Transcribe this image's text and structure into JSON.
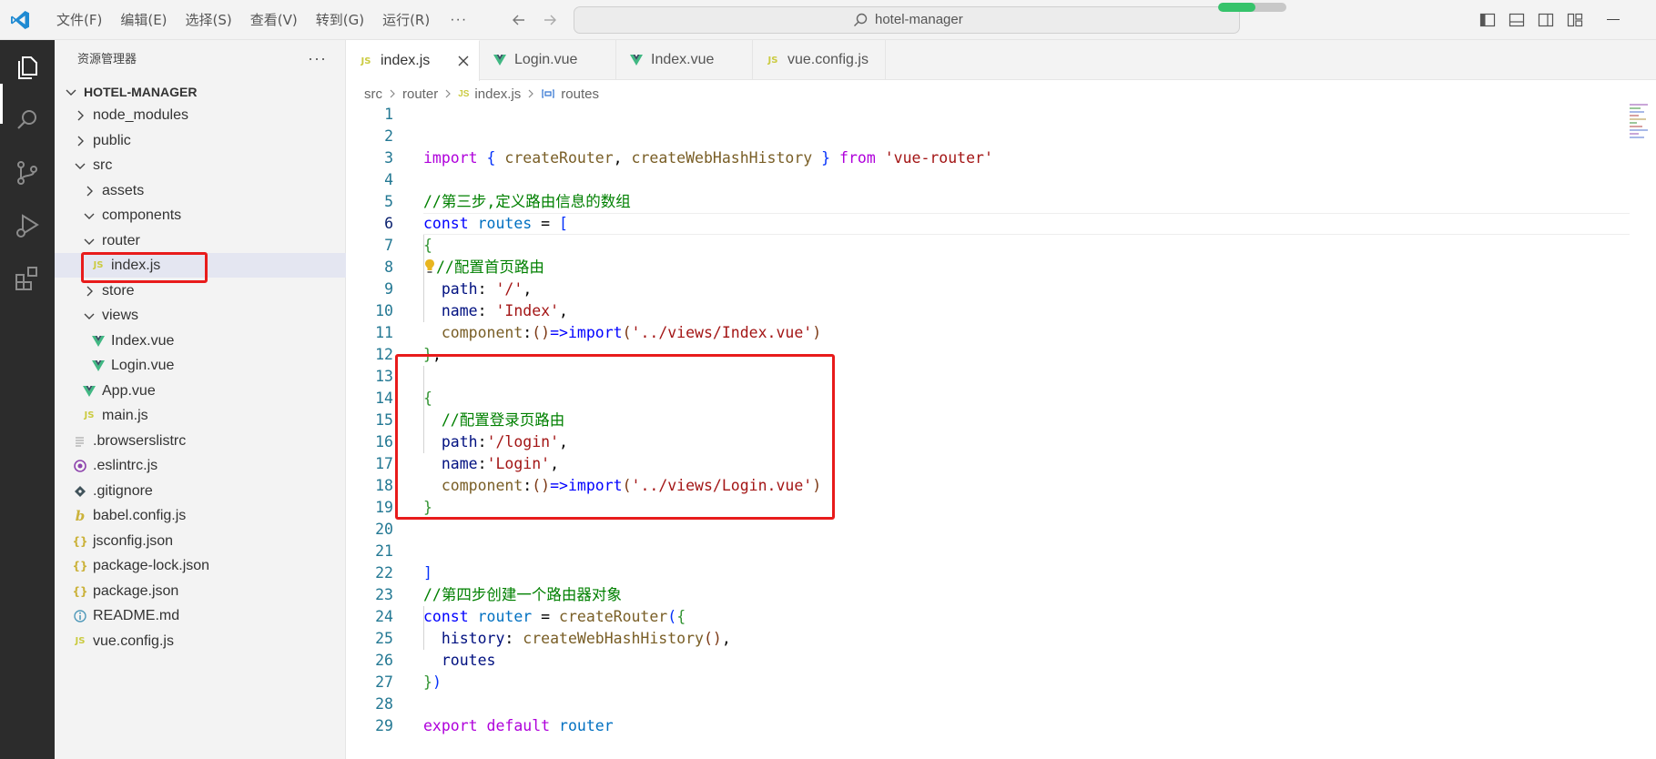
{
  "titlebar": {
    "menu": [
      "文件(F)",
      "编辑(E)",
      "选择(S)",
      "查看(V)",
      "转到(G)",
      "运行(R)"
    ],
    "more": "···",
    "command_center_title": "hotel-manager",
    "progress_fraction": 0.55
  },
  "sidebar": {
    "header": "资源管理器",
    "more": "···",
    "root": "HOTEL-MANAGER",
    "items": [
      {
        "label": "node_modules"
      },
      {
        "label": "public"
      },
      {
        "label": "src"
      },
      {
        "label": "assets"
      },
      {
        "label": "components"
      },
      {
        "label": "router"
      },
      {
        "label": "index.js"
      },
      {
        "label": "store"
      },
      {
        "label": "views"
      },
      {
        "label": "Index.vue"
      },
      {
        "label": "Login.vue"
      },
      {
        "label": "App.vue"
      },
      {
        "label": "main.js"
      },
      {
        "label": ".browserslistrc"
      },
      {
        "label": ".eslintrc.js"
      },
      {
        "label": ".gitignore"
      },
      {
        "label": "babel.config.js"
      },
      {
        "label": "jsconfig.json"
      },
      {
        "label": "package-lock.json"
      },
      {
        "label": "package.json"
      },
      {
        "label": "README.md"
      },
      {
        "label": "vue.config.js"
      }
    ]
  },
  "tabs": [
    {
      "label": "index.js",
      "icon": "JS"
    },
    {
      "label": "Login.vue",
      "icon": "V"
    },
    {
      "label": "Index.vue",
      "icon": "V"
    },
    {
      "label": "vue.config.js",
      "icon": "JS"
    }
  ],
  "breadcrumb": {
    "parts": [
      "src",
      "router",
      "index.js",
      "routes"
    ],
    "file_icon": "JS"
  },
  "editor": {
    "current_line": 6,
    "line_numbers": [
      "1",
      "2",
      "3",
      "4",
      "5",
      "6",
      "7",
      "8",
      "9",
      "10",
      "11",
      "12",
      "13",
      "14",
      "15",
      "16",
      "17",
      "18",
      "19",
      "20",
      "21",
      "22",
      "23",
      "24",
      "25",
      "26",
      "27",
      "28",
      "29"
    ],
    "t": {
      "import": "import",
      "lbrace": "{",
      "createRouter": "createRouter",
      "comma": ",",
      "createWebHashHistory": "createWebHashHistory",
      "rbrace": "}",
      "from": "from",
      "vue_router": "'vue-router'",
      "comment_step3": "//第三步,定义路由信息的数组",
      "const": "const",
      "routes": "routes",
      "eq": "=",
      "lbracket": "[",
      "comment_home": "//配置首页路由",
      "path": "path",
      "colon": ":",
      "slash_str": "'/'",
      "name": "name",
      "index_str": "'Index'",
      "component": "component",
      "arrow_lp": "(",
      "arrow_rp": ")",
      "arrow": "=>",
      "index_vue": "'../views/Index.vue'",
      "rbrace_comma": "},",
      "comment_login": "//配置登录页路由",
      "login_path": "'/login'",
      "login_name": "'Login'",
      "login_vue": "'../views/Login.vue'",
      "rbracket": "]",
      "comment_step4": "//第四步创建一个路由器对象",
      "router": "router",
      "history": "history",
      "call_empty": "()",
      "export": "export",
      "default": "default"
    }
  },
  "colors": {
    "accent_red": "#e81b1b",
    "activity_bg": "#2c2c2c",
    "vue_green": "#41b883",
    "js_yellow": "#cbcb41"
  }
}
